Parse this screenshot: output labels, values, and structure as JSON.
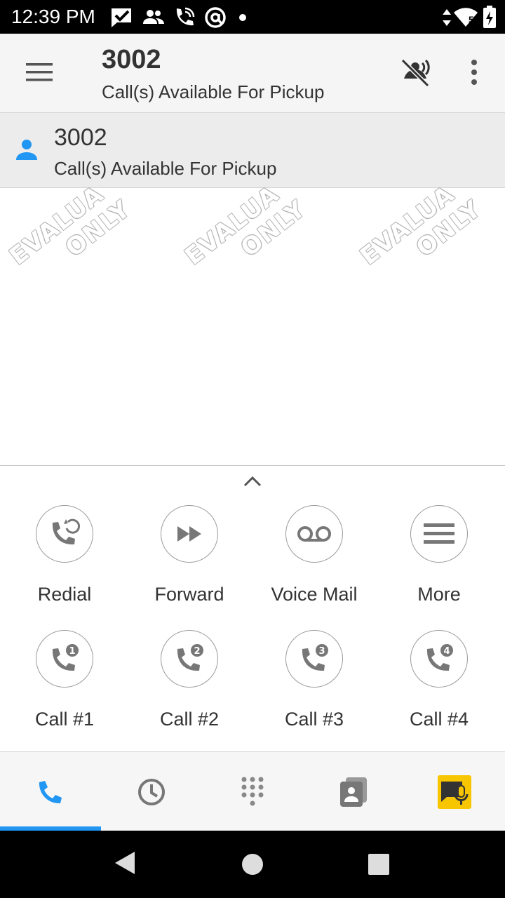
{
  "status_bar": {
    "time": "12:39 PM",
    "wifi_badge": "5"
  },
  "toolbar": {
    "title": "3002",
    "subtitle": "Call(s) Available For Pickup",
    "menu_icon": "hamburger-icon",
    "mute_icon": "speaker-off-icon",
    "overflow_icon": "more-vert-icon"
  },
  "line": {
    "title": "3002",
    "subtitle": "Call(s) Available For Pickup",
    "icon": "person-icon",
    "icon_color": "#2196f3"
  },
  "watermark": {
    "line1": "EVALUA",
    "line2": "ONLY"
  },
  "actions": [
    {
      "label": "Redial",
      "icon": "redial-icon"
    },
    {
      "label": "Forward",
      "icon": "fast-forward-icon"
    },
    {
      "label": "Voice Mail",
      "icon": "voicemail-icon"
    },
    {
      "label": "More",
      "icon": "menu-lines-icon"
    },
    {
      "label": "Call #1",
      "icon": "call-1-icon"
    },
    {
      "label": "Call #2",
      "icon": "call-2-icon"
    },
    {
      "label": "Call #3",
      "icon": "call-3-icon"
    },
    {
      "label": "Call #4",
      "icon": "call-4-icon"
    }
  ],
  "bottom_nav": {
    "tabs": [
      "phone-icon",
      "history-icon",
      "dialpad-icon",
      "contacts-icon",
      "voice-messaging-icon"
    ],
    "active_tab": 0,
    "active_color": "#2196f3",
    "voice_tab_bg": "#f7c600"
  }
}
